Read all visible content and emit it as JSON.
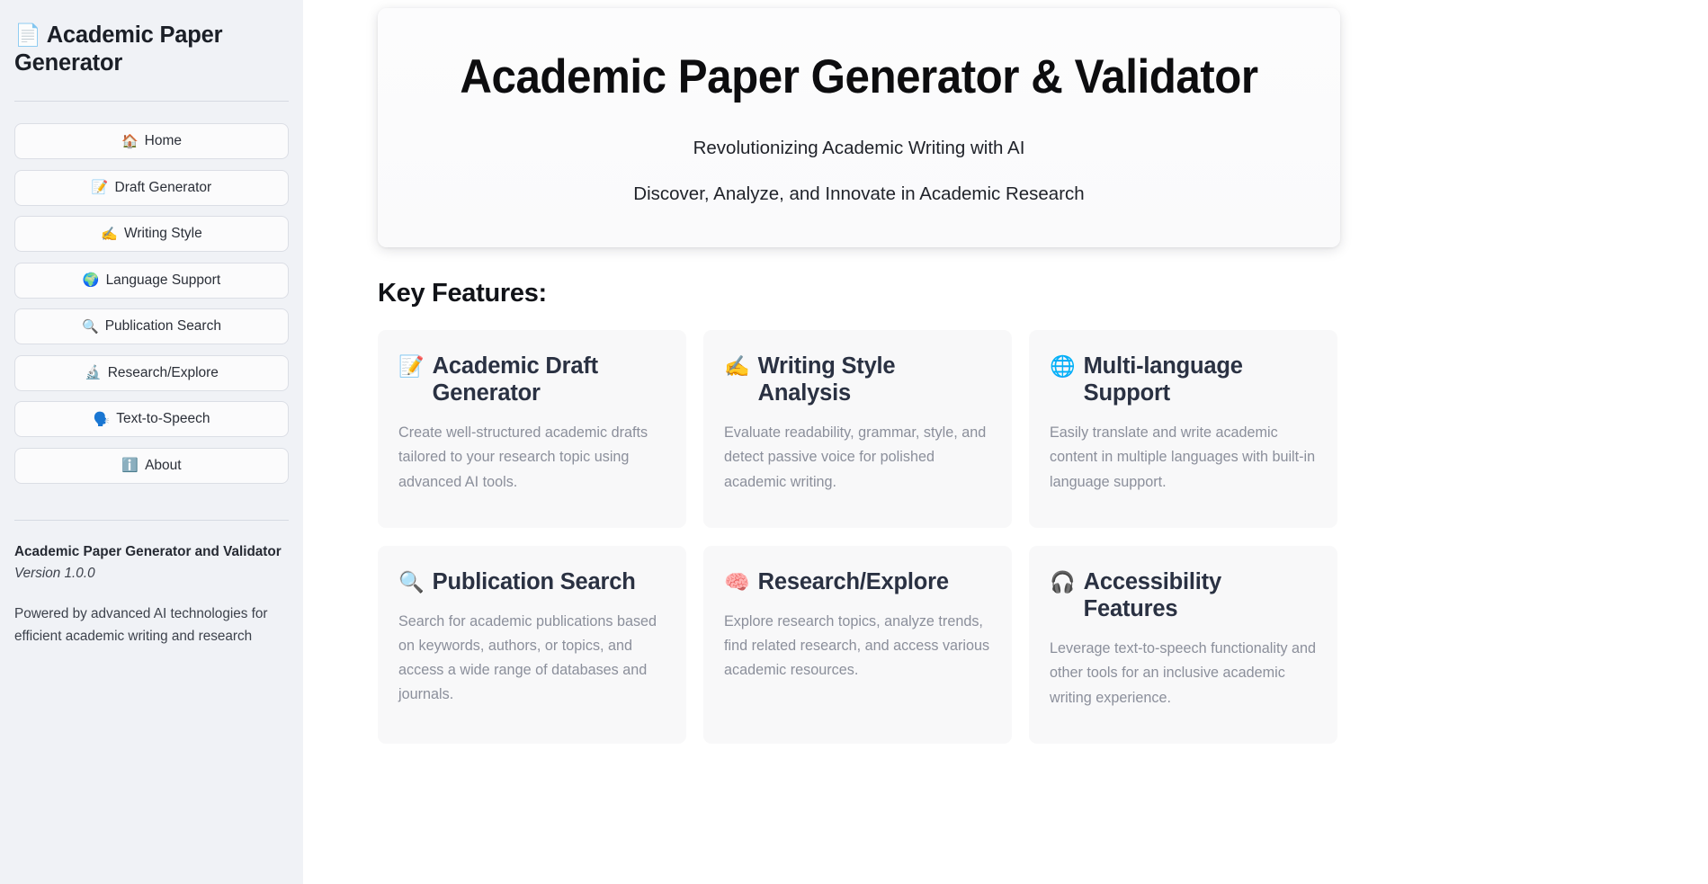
{
  "sidebar": {
    "brand_icon": "📄",
    "brand_icon_name": "document-icon",
    "title": "Academic Paper Generator",
    "nav_items": [
      {
        "icon": "🏠",
        "icon_name": "house-icon",
        "label": "Home"
      },
      {
        "icon": "📝",
        "icon_name": "memo-icon",
        "label": "Draft Generator"
      },
      {
        "icon": "✍️",
        "icon_name": "writing-hand-icon",
        "label": "Writing Style"
      },
      {
        "icon": "🌍",
        "icon_name": "globe-europe-africa-icon",
        "label": "Language Support"
      },
      {
        "icon": "🔍",
        "icon_name": "magnifying-glass-icon",
        "label": "Publication Search"
      },
      {
        "icon": "🔬",
        "icon_name": "microscope-icon",
        "label": "Research/Explore"
      },
      {
        "icon": "🗣️",
        "icon_name": "speaking-head-icon",
        "label": "Text-to-Speech"
      },
      {
        "icon": "ℹ️",
        "icon_name": "information-icon",
        "label": "About"
      }
    ],
    "footer": {
      "title": "Academic Paper Generator and Validator",
      "version": "Version 1.0.0",
      "description": "Powered by advanced AI technologies for efficient academic writing and research"
    }
  },
  "hero": {
    "title": "Academic Paper Generator & Validator",
    "subtitle1": "Revolutionizing Academic Writing with AI",
    "subtitle2": "Discover, Analyze, and Innovate in Academic Research"
  },
  "features": {
    "section_title": "Key Features:",
    "cards": [
      {
        "icon": "📝",
        "icon_name": "memo-icon",
        "title": "Academic Draft Generator",
        "description": "Create well-structured academic drafts tailored to your research topic using advanced AI tools."
      },
      {
        "icon": "✍️",
        "icon_name": "writing-hand-icon",
        "title": "Writing Style Analysis",
        "description": "Evaluate readability, grammar, style, and detect passive voice for polished academic writing."
      },
      {
        "icon": "🌐",
        "icon_name": "globe-meridians-icon",
        "title": "Multi-language Support",
        "description": "Easily translate and write academic content in multiple languages with built-in language support."
      },
      {
        "icon": "🔍",
        "icon_name": "magnifying-glass-icon",
        "title": "Publication Search",
        "description": "Search for academic publications based on keywords, authors, or topics, and access a wide range of databases and journals."
      },
      {
        "icon": "🧠",
        "icon_name": "brain-icon",
        "title": "Research/Explore",
        "description": "Explore research topics, analyze trends, find related research, and access various academic resources."
      },
      {
        "icon": "🎧",
        "icon_name": "headphone-icon",
        "title": "Accessibility Features",
        "description": "Leverage text-to-speech functionality and other tools for an inclusive academic writing experience."
      }
    ]
  },
  "theme": {
    "sidebar_bg": "#f0f2f6",
    "card_bg": "#f8f8f9",
    "title_color": "#2a3142",
    "body_text_color": "#8b8f9b"
  }
}
